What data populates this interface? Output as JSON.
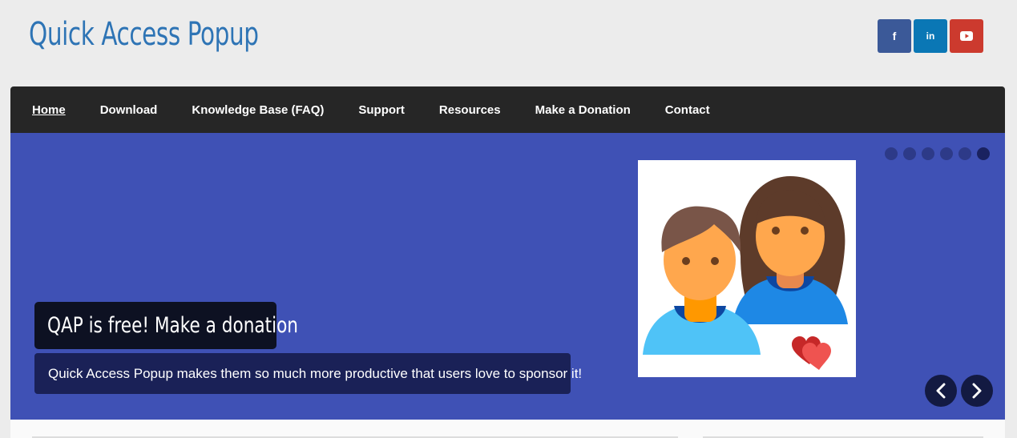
{
  "header": {
    "site_title": "Quick Access Popup",
    "social": [
      {
        "name": "facebook",
        "label": "f",
        "color": "#3b5998"
      },
      {
        "name": "linkedin",
        "label": "in",
        "color": "#0a77b5"
      },
      {
        "name": "youtube",
        "icon": "play-icon",
        "color": "#cc3a2e"
      }
    ]
  },
  "nav": {
    "items": [
      {
        "label": "Home",
        "active": true
      },
      {
        "label": "Download"
      },
      {
        "label": "Knowledge Base (FAQ)"
      },
      {
        "label": "Support"
      },
      {
        "label": "Resources"
      },
      {
        "label": "Make a Donation"
      },
      {
        "label": "Contact"
      }
    ]
  },
  "slider": {
    "background": "#3f51b5",
    "slide_count": 6,
    "active_index": 5,
    "title": "QAP is free! Make a donation",
    "description": "Quick Access Popup makes them so much more productive that users love to sponsor it!",
    "image_icon": "users-heart-illustration",
    "prev_icon": "chevron-left-icon",
    "next_icon": "chevron-right-icon"
  }
}
